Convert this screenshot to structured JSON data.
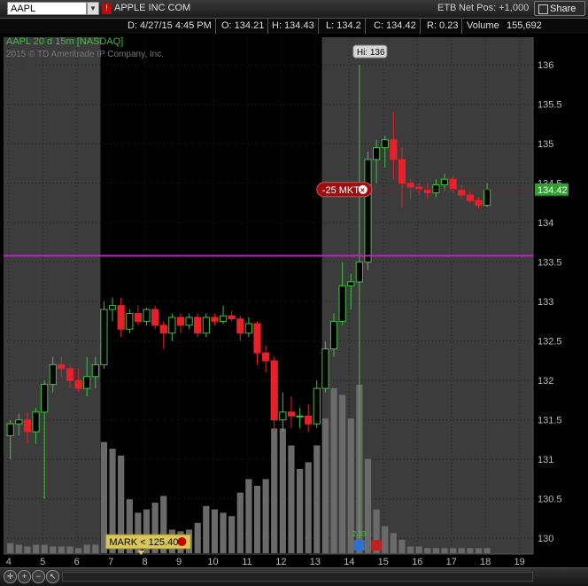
{
  "header": {
    "symbol": "AAPL",
    "flag": "!",
    "company": "APPLE INC COM",
    "exchange": "ETB",
    "net_pos": "Net Pos: +1,000",
    "share_label": "Share"
  },
  "info": {
    "date": "D: 4/27/15 4:45 PM",
    "open": "O: 134.21",
    "high": "H: 134.43",
    "low": "L: 134.2",
    "close": "C: 134.42",
    "range": "R: 0.23",
    "volume_label": "Volume",
    "volume": "155,692"
  },
  "chart_title": "AAPL 20 d 15m [NASDAQ]",
  "copyright": "2015 © TD Ameritrade IP Company, Inc.",
  "icons": [
    "apple-logo-icon",
    "crosshair-icon",
    "zoom-in-icon",
    "zoom-out-icon",
    "pointer-icon",
    "dropdown-icon",
    "share-icon",
    "close-icon",
    "phone-icon",
    "marker-icon"
  ],
  "chart_data": {
    "type": "candlestick",
    "xlabel": "",
    "ylabel": "",
    "x_ticks": [
      "4",
      "5",
      "6",
      "7",
      "8",
      "9",
      "10",
      "11",
      "12",
      "13",
      "14",
      "15",
      "16",
      "17",
      "18",
      "19"
    ],
    "y_ticks": [
      "130",
      "130.5",
      "131",
      "131.5",
      "132",
      "132.5",
      "133",
      "133.5",
      "134",
      "134.5",
      "135",
      "135.5",
      "136"
    ],
    "ylim": [
      129.8,
      136.35
    ],
    "xlim": [
      3.85,
      19.4
    ],
    "horizontal_line": 133.58,
    "hi_label": "Hi: 136",
    "hi_value": 136,
    "last_price_label": "134.42",
    "last_price": 134.42,
    "order_label": "-25 MKT",
    "order_price": 134.42,
    "alert_label": "MARK < 125.40",
    "volume_small_label": "2.33",
    "candles": [
      {
        "x": 4.05,
        "o": 131.3,
        "h": 131.5,
        "l": 131.0,
        "c": 131.45
      },
      {
        "x": 4.3,
        "o": 131.45,
        "h": 131.58,
        "l": 131.3,
        "c": 131.5
      },
      {
        "x": 4.55,
        "o": 131.5,
        "h": 131.6,
        "l": 131.2,
        "c": 131.35
      },
      {
        "x": 4.8,
        "o": 131.35,
        "h": 131.65,
        "l": 131.2,
        "c": 131.6
      },
      {
        "x": 5.05,
        "o": 131.6,
        "h": 132.0,
        "l": 130.5,
        "c": 131.95
      },
      {
        "x": 5.3,
        "o": 131.95,
        "h": 132.3,
        "l": 131.85,
        "c": 132.2
      },
      {
        "x": 5.55,
        "o": 132.2,
        "h": 132.3,
        "l": 132.05,
        "c": 132.15
      },
      {
        "x": 5.8,
        "o": 132.15,
        "h": 132.2,
        "l": 131.9,
        "c": 132.0
      },
      {
        "x": 6.05,
        "o": 132.0,
        "h": 132.15,
        "l": 131.85,
        "c": 131.9
      },
      {
        "x": 6.3,
        "o": 131.9,
        "h": 132.3,
        "l": 131.8,
        "c": 132.05
      },
      {
        "x": 6.55,
        "o": 132.05,
        "h": 132.3,
        "l": 131.9,
        "c": 132.2
      },
      {
        "x": 6.8,
        "o": 132.2,
        "h": 133.0,
        "l": 132.15,
        "c": 132.9
      },
      {
        "x": 7.05,
        "o": 132.9,
        "h": 133.05,
        "l": 132.75,
        "c": 132.95
      },
      {
        "x": 7.3,
        "o": 132.95,
        "h": 133.05,
        "l": 132.55,
        "c": 132.65
      },
      {
        "x": 7.55,
        "o": 132.65,
        "h": 132.9,
        "l": 132.6,
        "c": 132.85
      },
      {
        "x": 7.8,
        "o": 132.85,
        "h": 132.95,
        "l": 132.7,
        "c": 132.75
      },
      {
        "x": 8.05,
        "o": 132.75,
        "h": 132.92,
        "l": 132.7,
        "c": 132.9
      },
      {
        "x": 8.3,
        "o": 132.9,
        "h": 132.95,
        "l": 132.65,
        "c": 132.7
      },
      {
        "x": 8.55,
        "o": 132.7,
        "h": 132.75,
        "l": 132.4,
        "c": 132.6
      },
      {
        "x": 8.8,
        "o": 132.6,
        "h": 132.85,
        "l": 132.5,
        "c": 132.8
      },
      {
        "x": 9.05,
        "o": 132.8,
        "h": 132.85,
        "l": 132.6,
        "c": 132.7
      },
      {
        "x": 9.3,
        "o": 132.7,
        "h": 132.85,
        "l": 132.65,
        "c": 132.8
      },
      {
        "x": 9.55,
        "o": 132.8,
        "h": 132.85,
        "l": 132.55,
        "c": 132.6
      },
      {
        "x": 9.8,
        "o": 132.6,
        "h": 132.85,
        "l": 132.55,
        "c": 132.8
      },
      {
        "x": 10.05,
        "o": 132.8,
        "h": 132.85,
        "l": 132.7,
        "c": 132.75
      },
      {
        "x": 10.3,
        "o": 132.75,
        "h": 132.95,
        "l": 132.72,
        "c": 132.82
      },
      {
        "x": 10.55,
        "o": 132.82,
        "h": 132.88,
        "l": 132.75,
        "c": 132.78
      },
      {
        "x": 10.8,
        "o": 132.78,
        "h": 132.82,
        "l": 132.5,
        "c": 132.6
      },
      {
        "x": 11.05,
        "o": 132.6,
        "h": 132.8,
        "l": 132.55,
        "c": 132.72
      },
      {
        "x": 11.3,
        "o": 132.72,
        "h": 132.75,
        "l": 132.2,
        "c": 132.35
      },
      {
        "x": 11.55,
        "o": 132.35,
        "h": 132.45,
        "l": 132.1,
        "c": 132.25
      },
      {
        "x": 11.8,
        "o": 132.25,
        "h": 132.3,
        "l": 131.35,
        "c": 131.5
      },
      {
        "x": 12.05,
        "o": 131.5,
        "h": 131.85,
        "l": 131.35,
        "c": 131.6
      },
      {
        "x": 12.3,
        "o": 131.6,
        "h": 131.8,
        "l": 131.4,
        "c": 131.55
      },
      {
        "x": 12.55,
        "o": 131.55,
        "h": 131.65,
        "l": 131.4,
        "c": 131.55
      },
      {
        "x": 12.8,
        "o": 131.55,
        "h": 131.7,
        "l": 131.35,
        "c": 131.45
      },
      {
        "x": 13.05,
        "o": 131.45,
        "h": 132.0,
        "l": 131.4,
        "c": 131.9
      },
      {
        "x": 13.3,
        "o": 131.9,
        "h": 132.5,
        "l": 131.85,
        "c": 132.4
      },
      {
        "x": 13.55,
        "o": 132.4,
        "h": 132.85,
        "l": 132.3,
        "c": 132.75
      },
      {
        "x": 13.8,
        "o": 132.75,
        "h": 133.5,
        "l": 132.7,
        "c": 133.2
      },
      {
        "x": 14.05,
        "o": 133.2,
        "h": 133.35,
        "l": 132.9,
        "c": 133.25
      },
      {
        "x": 14.3,
        "o": 133.25,
        "h": 136.0,
        "l": 130.0,
        "c": 133.5
      },
      {
        "x": 14.55,
        "o": 133.5,
        "h": 134.9,
        "l": 133.4,
        "c": 134.8
      },
      {
        "x": 14.8,
        "o": 134.8,
        "h": 135.05,
        "l": 134.5,
        "c": 134.95
      },
      {
        "x": 15.05,
        "o": 134.95,
        "h": 135.1,
        "l": 134.7,
        "c": 135.05
      },
      {
        "x": 15.3,
        "o": 135.05,
        "h": 135.4,
        "l": 134.55,
        "c": 134.8
      },
      {
        "x": 15.55,
        "o": 134.8,
        "h": 134.95,
        "l": 134.2,
        "c": 134.5
      },
      {
        "x": 15.8,
        "o": 134.5,
        "h": 134.55,
        "l": 134.3,
        "c": 134.45
      },
      {
        "x": 16.05,
        "o": 134.45,
        "h": 134.5,
        "l": 134.35,
        "c": 134.42
      },
      {
        "x": 16.3,
        "o": 134.42,
        "h": 134.5,
        "l": 134.3,
        "c": 134.38
      },
      {
        "x": 16.55,
        "o": 134.38,
        "h": 134.55,
        "l": 134.32,
        "c": 134.48
      },
      {
        "x": 16.8,
        "o": 134.48,
        "h": 134.62,
        "l": 134.4,
        "c": 134.55
      },
      {
        "x": 17.05,
        "o": 134.55,
        "h": 134.6,
        "l": 134.38,
        "c": 134.42
      },
      {
        "x": 17.3,
        "o": 134.42,
        "h": 134.48,
        "l": 134.3,
        "c": 134.35
      },
      {
        "x": 17.55,
        "o": 134.35,
        "h": 134.4,
        "l": 134.25,
        "c": 134.28
      },
      {
        "x": 17.8,
        "o": 134.28,
        "h": 134.32,
        "l": 134.18,
        "c": 134.22
      },
      {
        "x": 18.05,
        "o": 134.22,
        "h": 134.5,
        "l": 134.2,
        "c": 134.42
      }
    ],
    "volumes": [
      {
        "x": 4.05,
        "v": 6
      },
      {
        "x": 4.3,
        "v": 5
      },
      {
        "x": 4.55,
        "v": 4
      },
      {
        "x": 4.8,
        "v": 5
      },
      {
        "x": 5.05,
        "v": 5
      },
      {
        "x": 5.3,
        "v": 4
      },
      {
        "x": 5.55,
        "v": 4
      },
      {
        "x": 5.8,
        "v": 4
      },
      {
        "x": 6.05,
        "v": 3
      },
      {
        "x": 6.3,
        "v": 5
      },
      {
        "x": 6.55,
        "v": 5
      },
      {
        "x": 6.8,
        "v": 66
      },
      {
        "x": 7.05,
        "v": 62
      },
      {
        "x": 7.3,
        "v": 58
      },
      {
        "x": 7.55,
        "v": 32
      },
      {
        "x": 7.8,
        "v": 24
      },
      {
        "x": 8.05,
        "v": 26
      },
      {
        "x": 8.3,
        "v": 30
      },
      {
        "x": 8.55,
        "v": 34
      },
      {
        "x": 8.8,
        "v": 14
      },
      {
        "x": 9.05,
        "v": 13
      },
      {
        "x": 9.3,
        "v": 14
      },
      {
        "x": 9.55,
        "v": 18
      },
      {
        "x": 9.8,
        "v": 28
      },
      {
        "x": 10.05,
        "v": 26
      },
      {
        "x": 10.3,
        "v": 24
      },
      {
        "x": 10.55,
        "v": 22
      },
      {
        "x": 10.8,
        "v": 36
      },
      {
        "x": 11.05,
        "v": 44
      },
      {
        "x": 11.3,
        "v": 40
      },
      {
        "x": 11.55,
        "v": 44
      },
      {
        "x": 11.8,
        "v": 74
      },
      {
        "x": 12.05,
        "v": 74
      },
      {
        "x": 12.3,
        "v": 64
      },
      {
        "x": 12.55,
        "v": 50
      },
      {
        "x": 12.8,
        "v": 54
      },
      {
        "x": 13.05,
        "v": 64
      },
      {
        "x": 13.3,
        "v": 80
      },
      {
        "x": 13.55,
        "v": 98
      },
      {
        "x": 13.8,
        "v": 94
      },
      {
        "x": 14.05,
        "v": 80
      },
      {
        "x": 14.3,
        "v": 100
      },
      {
        "x": 14.55,
        "v": 56
      },
      {
        "x": 14.8,
        "v": 26
      },
      {
        "x": 15.05,
        "v": 16
      },
      {
        "x": 15.3,
        "v": 12
      },
      {
        "x": 15.55,
        "v": 8
      },
      {
        "x": 15.8,
        "v": 4
      },
      {
        "x": 16.05,
        "v": 4
      },
      {
        "x": 16.3,
        "v": 3
      },
      {
        "x": 16.55,
        "v": 3
      },
      {
        "x": 16.8,
        "v": 3
      },
      {
        "x": 17.05,
        "v": 3
      },
      {
        "x": 17.3,
        "v": 3
      },
      {
        "x": 17.55,
        "v": 3
      },
      {
        "x": 17.8,
        "v": 3
      },
      {
        "x": 18.05,
        "v": 3
      }
    ],
    "session_shading": [
      {
        "from": 3.85,
        "to": 6.7,
        "color": "#3c3c3c"
      },
      {
        "from": 6.7,
        "to": 13.2,
        "color": "#000000"
      },
      {
        "from": 13.2,
        "to": 19.4,
        "color": "#3c3c3c"
      }
    ],
    "colors": {
      "up": "#3ec13e",
      "down": "#e8202a",
      "hline": "#c020c0",
      "volume": "#6a6a6a"
    }
  }
}
